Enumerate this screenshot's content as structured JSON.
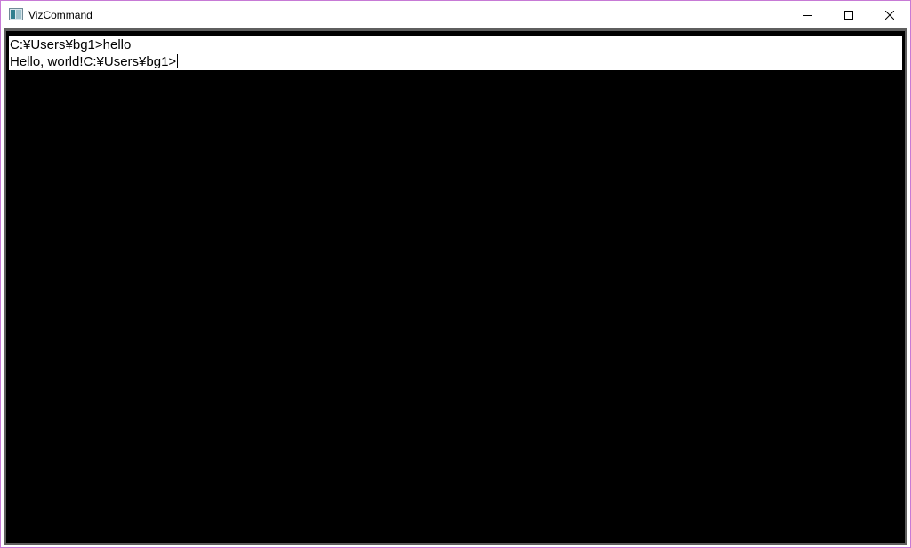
{
  "window": {
    "title": "VizCommand",
    "app_icon": "terminal-app-icon",
    "border_color": "#c77ad6"
  },
  "caption_buttons": {
    "minimize_icon": "minimize-icon",
    "maximize_icon": "maximize-icon",
    "close_icon": "close-icon"
  },
  "console": {
    "background": "#000000",
    "lines": [
      {
        "text": "C:¥Users¥bg1>hello"
      },
      {
        "text": "Hello, world!C:¥Users¥bg1>"
      }
    ]
  }
}
